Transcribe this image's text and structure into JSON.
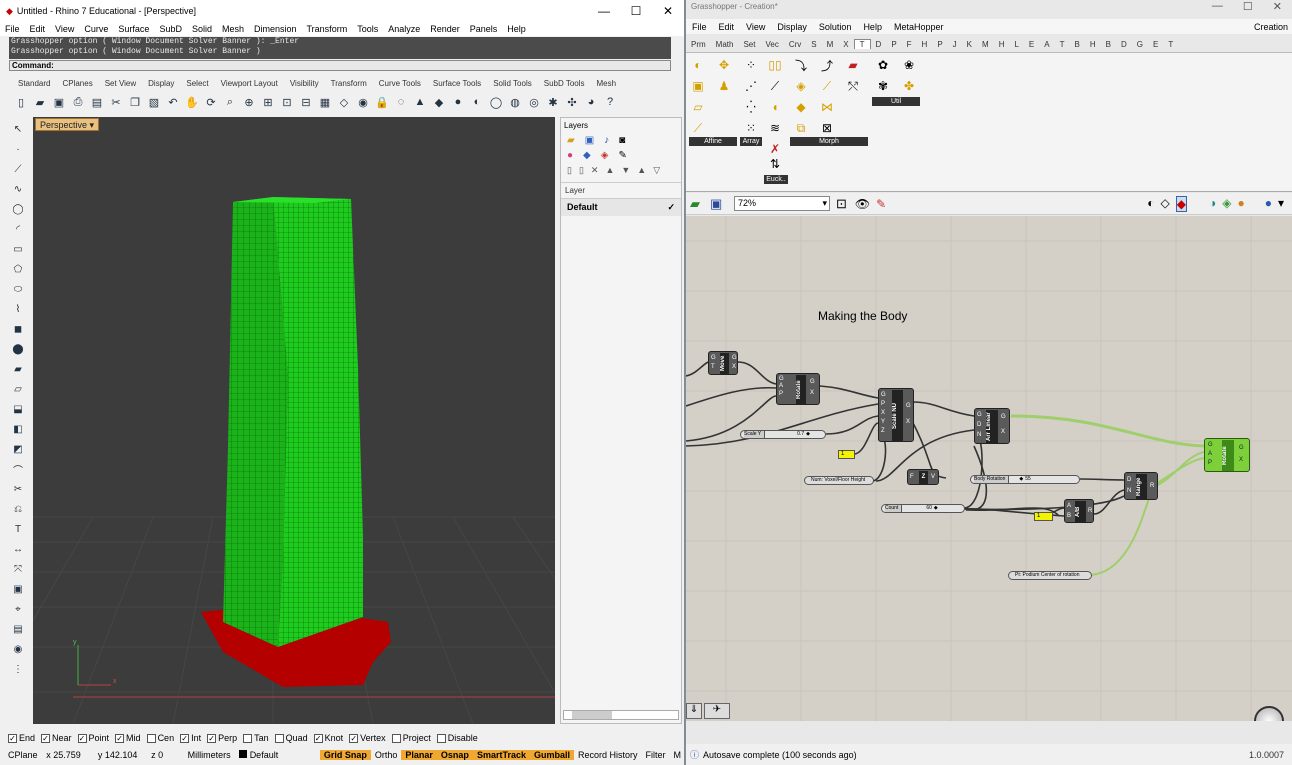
{
  "rhino": {
    "title": "Untitled - Rhino 7 Educational - [Perspective]",
    "menu": [
      "File",
      "Edit",
      "View",
      "Curve",
      "Surface",
      "SubD",
      "Solid",
      "Mesh",
      "Dimension",
      "Transform",
      "Tools",
      "Analyze",
      "Render",
      "Panels",
      "Help"
    ],
    "command_history": [
      "Grasshopper option ( Window Document Solver Banner ): _Enter",
      "Grasshopper option ( Window Document Solver Banner )"
    ],
    "command_label": "Command:",
    "toolbar_tabs": [
      "Standard",
      "CPlanes",
      "Set View",
      "Display",
      "Select",
      "Viewport Layout",
      "Visibility",
      "Transform",
      "Curve Tools",
      "Surface Tools",
      "Solid Tools",
      "SubD Tools",
      "Mesh"
    ],
    "viewport_label": "Perspective",
    "axis_labels": {
      "x": "x",
      "y": "y"
    },
    "layers": {
      "title": "Layers",
      "column": "Layer",
      "row": "Default"
    },
    "osnaps": [
      {
        "label": "End",
        "checked": true
      },
      {
        "label": "Near",
        "checked": true
      },
      {
        "label": "Point",
        "checked": true
      },
      {
        "label": "Mid",
        "checked": true
      },
      {
        "label": "Cen",
        "checked": false
      },
      {
        "label": "Int",
        "checked": true
      },
      {
        "label": "Perp",
        "checked": true
      },
      {
        "label": "Tan",
        "checked": false
      },
      {
        "label": "Quad",
        "checked": false
      },
      {
        "label": "Knot",
        "checked": true
      },
      {
        "label": "Vertex",
        "checked": true
      },
      {
        "label": "Project",
        "checked": false
      },
      {
        "label": "Disable",
        "checked": false
      }
    ],
    "status": {
      "cplane": "CPlane",
      "x": "x 25.759",
      "y": "y 142.104",
      "z": "z 0",
      "units": "Millimeters",
      "layer": "Default",
      "toggles": [
        {
          "label": "Grid Snap",
          "on": true
        },
        {
          "label": "Ortho",
          "on": false
        },
        {
          "label": "Planar",
          "on": true
        },
        {
          "label": "Osnap",
          "on": true
        },
        {
          "label": "SmartTrack",
          "on": true
        },
        {
          "label": "Gumball",
          "on": true
        },
        {
          "label": "Record History",
          "on": false
        },
        {
          "label": "Filter",
          "on": false
        },
        {
          "label": "M",
          "on": false
        }
      ]
    }
  },
  "gh": {
    "title": "Grasshopper - Creation*",
    "menu": [
      "File",
      "Edit",
      "View",
      "Display",
      "Solution",
      "Help",
      "MetaHopper"
    ],
    "doc_name": "Creation",
    "tabs": [
      "Prm",
      "Math",
      "Set",
      "Vec",
      "Crv",
      "S",
      "M",
      "X",
      "T",
      "D",
      "P",
      "F",
      "H",
      "P",
      "J",
      "K",
      "M",
      "H",
      "L",
      "E",
      "A",
      "T",
      "B",
      "H",
      "B",
      "D",
      "G",
      "E",
      "T"
    ],
    "active_tab_index": 8,
    "groups": [
      "Affine",
      "Array",
      "Euck..",
      "Morph",
      "Util"
    ],
    "zoom": "72%",
    "canvas_title": "Making the Body",
    "components": {
      "move": "Move",
      "rotate1": "Rotate",
      "scalenu": "Scale NU",
      "arrlinear": "Arr Linear",
      "z": "Z",
      "range": "Range",
      "ab": "A/B",
      "rotate2": "Rotate"
    },
    "sliders": {
      "scale_y": {
        "label": "Scale Y",
        "value": "0.7"
      },
      "body_rotation": {
        "label": "Body Rotation",
        "value": "55"
      },
      "count": {
        "label": "Count",
        "value": "60"
      }
    },
    "params": {
      "num": "Num: Voxel/Floor Height",
      "pt": "Pt: Podium Center of rotation"
    },
    "panel_values": {
      "p1": "1",
      "p2": "1"
    },
    "status": "Autosave complete (100 seconds ago)",
    "version": "1.0.0007"
  }
}
